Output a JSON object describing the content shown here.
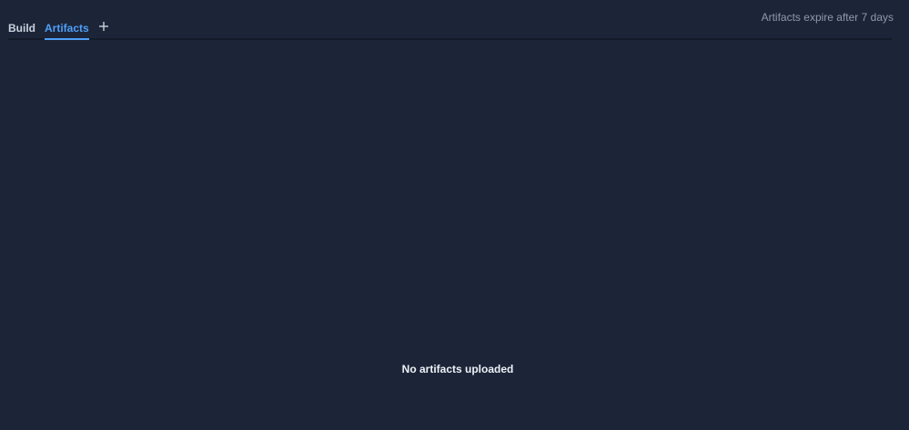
{
  "tabs": {
    "build_label": "Build",
    "artifacts_label": "Artifacts",
    "active": "Artifacts"
  },
  "icons": {
    "add_tab": "plus-icon"
  },
  "expiry_note": "Artifacts expire after 7 days",
  "empty_state": {
    "message": "No artifacts uploaded"
  },
  "colors": {
    "background": "#1c2538",
    "accent": "#4f9ef8",
    "muted_text": "#8e99ab"
  }
}
